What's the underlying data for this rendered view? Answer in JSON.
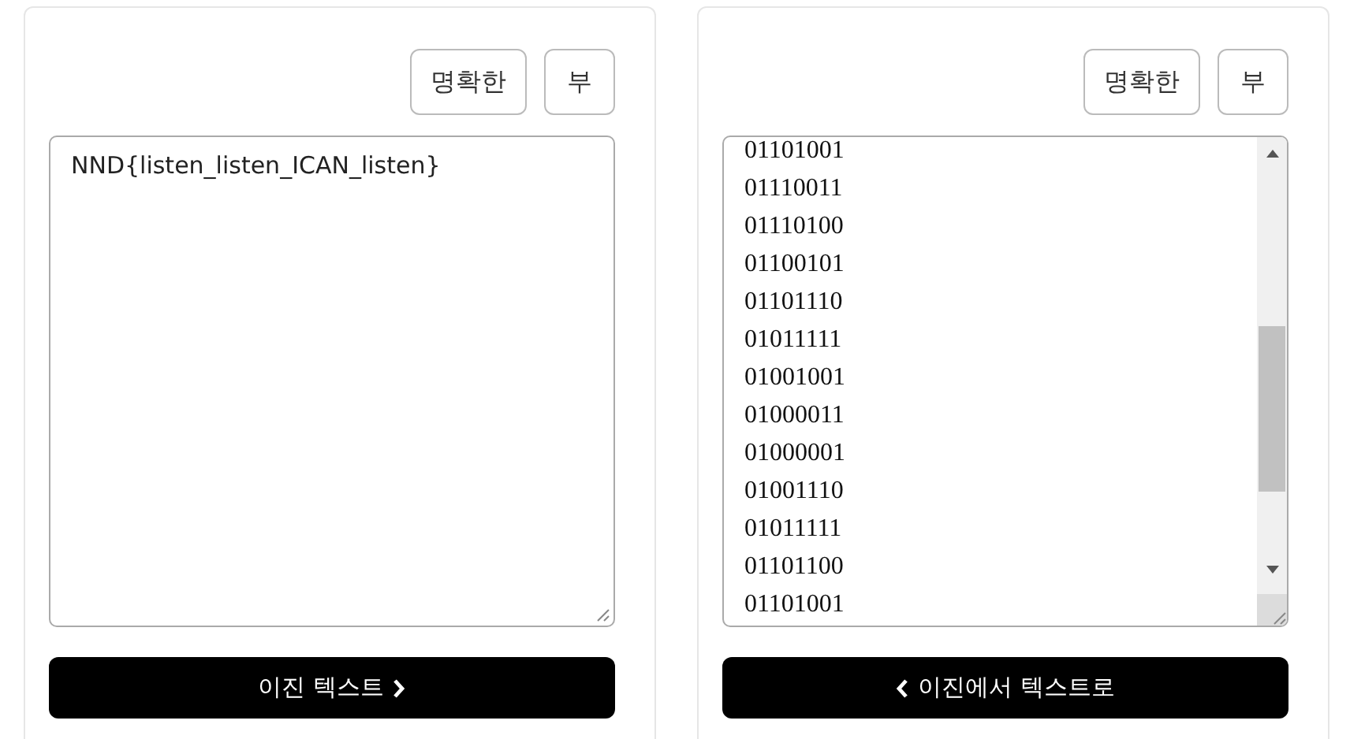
{
  "panels": [
    {
      "buttons": [
        "명확한",
        "부"
      ],
      "input": {
        "kind": "text",
        "value": "NND{listen_listen_ICAN_listen}"
      },
      "action": {
        "label": "이진 텍스트",
        "kind": "forward"
      }
    },
    {
      "buttons": [
        "명확한",
        "부"
      ],
      "input": {
        "kind": "lines",
        "lines": [
          "01101001",
          "01110011",
          "01110100",
          "01100101",
          "01101110",
          "01011111",
          "01001001",
          "01000011",
          "01000001",
          "01001110",
          "01011111",
          "01101100",
          "01101001"
        ]
      },
      "action": {
        "label": "이진에서 텍스트로",
        "kind": "back"
      }
    }
  ]
}
